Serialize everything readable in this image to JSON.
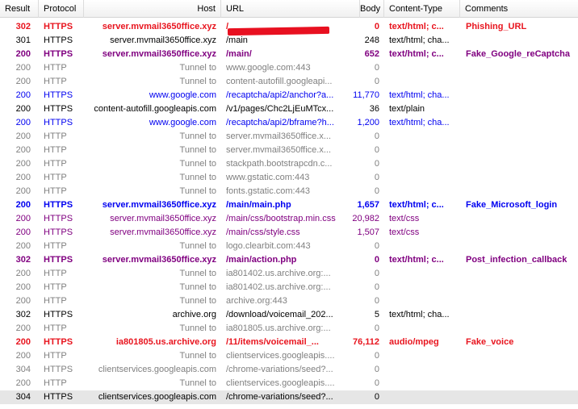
{
  "columns": {
    "result": "Result",
    "protocol": "Protocol",
    "host": "Host",
    "url": "URL",
    "body": "Body",
    "content_type": "Content-Type",
    "comments": "Comments"
  },
  "rows": [
    {
      "result": "302",
      "protocol": "HTTPS",
      "host": "server.mvmail3650ffice.xyz",
      "url": "/",
      "body": "0",
      "content_type": "text/html; c...",
      "comment": "Phishing_URL",
      "style": "g-red"
    },
    {
      "result": "301",
      "protocol": "HTTPS",
      "host": "server.mvmail3650ffice.xyz",
      "url": "/main",
      "body": "248",
      "content_type": "text/html; cha...",
      "comment": "",
      "style": "g-black"
    },
    {
      "result": "200",
      "protocol": "HTTPS",
      "host": "server.mvmail3650ffice.xyz",
      "url": "/main/",
      "body": "652",
      "content_type": "text/html; c...",
      "comment": "Fake_Google_reCaptcha",
      "style": "g-purple"
    },
    {
      "result": "200",
      "protocol": "HTTP",
      "host": "Tunnel to",
      "url": "www.google.com:443",
      "body": "0",
      "content_type": "",
      "comment": "",
      "style": "g-gray"
    },
    {
      "result": "200",
      "protocol": "HTTP",
      "host": "Tunnel to",
      "url": "content-autofill.googleapi...",
      "body": "0",
      "content_type": "",
      "comment": "",
      "style": "g-gray"
    },
    {
      "result": "200",
      "protocol": "HTTPS",
      "host": "www.google.com",
      "url": "/recaptcha/api2/anchor?a...",
      "body": "11,770",
      "content_type": "text/html; cha...",
      "comment": "",
      "style": "n-blue"
    },
    {
      "result": "200",
      "protocol": "HTTPS",
      "host": "content-autofill.googleapis.com",
      "url": "/v1/pages/Chc2LjEuMTcx...",
      "body": "36",
      "content_type": "text/plain",
      "comment": "",
      "style": "g-black"
    },
    {
      "result": "200",
      "protocol": "HTTPS",
      "host": "www.google.com",
      "url": "/recaptcha/api2/bframe?h...",
      "body": "1,200",
      "content_type": "text/html; cha...",
      "comment": "",
      "style": "n-blue"
    },
    {
      "result": "200",
      "protocol": "HTTP",
      "host": "Tunnel to",
      "url": "server.mvmail3650ffice.x...",
      "body": "0",
      "content_type": "",
      "comment": "",
      "style": "g-gray"
    },
    {
      "result": "200",
      "protocol": "HTTP",
      "host": "Tunnel to",
      "url": "server.mvmail3650ffice.x...",
      "body": "0",
      "content_type": "",
      "comment": "",
      "style": "g-gray"
    },
    {
      "result": "200",
      "protocol": "HTTP",
      "host": "Tunnel to",
      "url": "stackpath.bootstrapcdn.c...",
      "body": "0",
      "content_type": "",
      "comment": "",
      "style": "g-gray"
    },
    {
      "result": "200",
      "protocol": "HTTP",
      "host": "Tunnel to",
      "url": "www.gstatic.com:443",
      "body": "0",
      "content_type": "",
      "comment": "",
      "style": "g-gray"
    },
    {
      "result": "200",
      "protocol": "HTTP",
      "host": "Tunnel to",
      "url": "fonts.gstatic.com:443",
      "body": "0",
      "content_type": "",
      "comment": "",
      "style": "g-gray"
    },
    {
      "result": "200",
      "protocol": "HTTPS",
      "host": "server.mvmail3650ffice.xyz",
      "url": "/main/main.php",
      "body": "1,657",
      "content_type": "text/html; c...",
      "comment": "Fake_Microsoft_login",
      "style": "g-blue"
    },
    {
      "result": "200",
      "protocol": "HTTPS",
      "host": "server.mvmail3650ffice.xyz",
      "url": "/main/css/bootstrap.min.css",
      "body": "20,982",
      "content_type": "text/css",
      "comment": "",
      "style": "n-purple"
    },
    {
      "result": "200",
      "protocol": "HTTPS",
      "host": "server.mvmail3650ffice.xyz",
      "url": "/main/css/style.css",
      "body": "1,507",
      "content_type": "text/css",
      "comment": "",
      "style": "n-purple"
    },
    {
      "result": "200",
      "protocol": "HTTP",
      "host": "Tunnel to",
      "url": "logo.clearbit.com:443",
      "body": "0",
      "content_type": "",
      "comment": "",
      "style": "g-gray"
    },
    {
      "result": "302",
      "protocol": "HTTPS",
      "host": "server.mvmail3650ffice.xyz",
      "url": "/main/action.php",
      "body": "0",
      "content_type": "text/html; c...",
      "comment": "Post_infection_callback",
      "style": "g-purple"
    },
    {
      "result": "200",
      "protocol": "HTTP",
      "host": "Tunnel to",
      "url": "ia801402.us.archive.org:...",
      "body": "0",
      "content_type": "",
      "comment": "",
      "style": "g-gray"
    },
    {
      "result": "200",
      "protocol": "HTTP",
      "host": "Tunnel to",
      "url": "ia801402.us.archive.org:...",
      "body": "0",
      "content_type": "",
      "comment": "",
      "style": "g-gray"
    },
    {
      "result": "200",
      "protocol": "HTTP",
      "host": "Tunnel to",
      "url": "archive.org:443",
      "body": "0",
      "content_type": "",
      "comment": "",
      "style": "g-gray"
    },
    {
      "result": "302",
      "protocol": "HTTPS",
      "host": "archive.org",
      "url": "/download/voicemail_202...",
      "body": "5",
      "content_type": "text/html; cha...",
      "comment": "",
      "style": "g-black"
    },
    {
      "result": "200",
      "protocol": "HTTP",
      "host": "Tunnel to",
      "url": "ia801805.us.archive.org:...",
      "body": "0",
      "content_type": "",
      "comment": "",
      "style": "g-gray"
    },
    {
      "result": "200",
      "protocol": "HTTPS",
      "host": "ia801805.us.archive.org",
      "url": "/11/items/voicemail_...",
      "body": "76,112",
      "content_type": "audio/mpeg",
      "comment": "Fake_voice",
      "style": "g-red"
    },
    {
      "result": "200",
      "protocol": "HTTP",
      "host": "Tunnel to",
      "url": "clientservices.googleapis....",
      "body": "0",
      "content_type": "",
      "comment": "",
      "style": "g-gray"
    },
    {
      "result": "304",
      "protocol": "HTTPS",
      "host": "clientservices.googleapis.com",
      "url": "/chrome-variations/seed?...",
      "body": "0",
      "content_type": "",
      "comment": "",
      "style": "g-gray"
    },
    {
      "result": "200",
      "protocol": "HTTP",
      "host": "Tunnel to",
      "url": "clientservices.googleapis....",
      "body": "0",
      "content_type": "",
      "comment": "",
      "style": "g-gray"
    },
    {
      "result": "304",
      "protocol": "HTTPS",
      "host": "clientservices.googleapis.com",
      "url": "/chrome-variations/seed?...",
      "body": "0",
      "content_type": "",
      "comment": "",
      "style": "g-black",
      "selected": true
    }
  ],
  "colors": {
    "red": "#e8141e",
    "purple": "#800080",
    "blue": "#0000f0",
    "gray": "#808080",
    "selected_row": "#e6e6e6"
  }
}
